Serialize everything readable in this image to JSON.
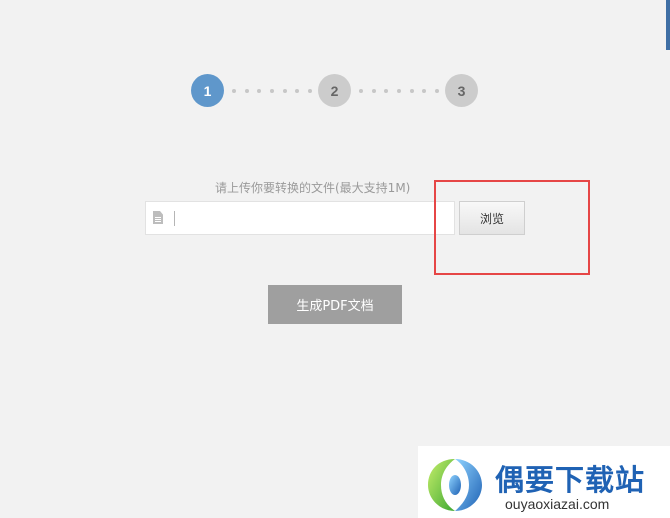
{
  "stepper": {
    "steps": [
      {
        "label": "1",
        "state": "active"
      },
      {
        "label": "2",
        "state": "inactive"
      },
      {
        "label": "3",
        "state": "inactive"
      }
    ],
    "active_color": "#5f97cb",
    "inactive_color": "#cccccc"
  },
  "upload": {
    "hint": "请上传你要转换的文件(最大支持1M)",
    "file_value": "",
    "file_icon": "file-icon",
    "browse_label": "浏览"
  },
  "actions": {
    "generate_label": "生成PDF文档",
    "generate_color": "#9f9f9f"
  },
  "annotation": {
    "highlight_color": "#e64646"
  },
  "watermark": {
    "title": "偶要下载站",
    "url": "ouyaoxiazai.com",
    "brand_color": "#1f62b4"
  }
}
